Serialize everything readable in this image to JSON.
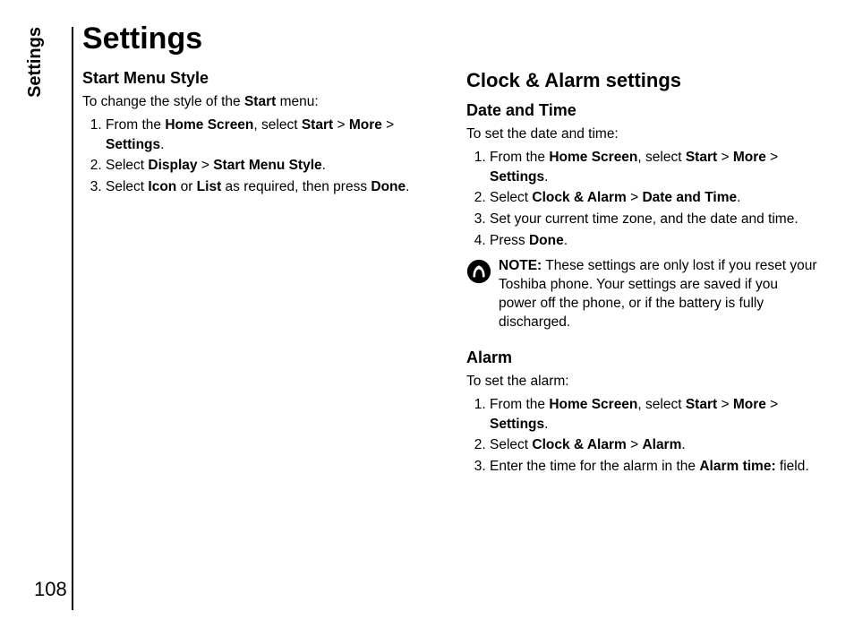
{
  "sideLabel": "Settings",
  "pageNumber": "108",
  "title": "Settings",
  "left": {
    "h": "Start Menu Style",
    "intro_pre": "To change the style of the ",
    "intro_b": "Start",
    "intro_post": " menu:",
    "s1_a": "From the ",
    "s1_b": "Home Screen",
    "s1_c": ", select ",
    "s1_d": "Start",
    "s1_e": " > ",
    "s1_f": "More",
    "s1_g": " > ",
    "s1_h": "Settings",
    "s1_i": ".",
    "s2_a": "Select ",
    "s2_b": "Display",
    "s2_c": " > ",
    "s2_d": "Start Menu Style",
    "s2_e": ".",
    "s3_a": "Select ",
    "s3_b": "Icon",
    "s3_c": " or ",
    "s3_d": "List",
    "s3_e": " as required, then press ",
    "s3_f": "Done",
    "s3_g": "."
  },
  "right": {
    "h": "Clock & Alarm settings",
    "dt": {
      "h": "Date and Time",
      "intro": "To set the date and time:",
      "s1_a": "From the ",
      "s1_b": "Home Screen",
      "s1_c": ", select ",
      "s1_d": "Start",
      "s1_e": " > ",
      "s1_f": "More",
      "s1_g": " > ",
      "s1_h": "Settings",
      "s1_i": ".",
      "s2_a": "Select ",
      "s2_b": "Clock & Alarm",
      "s2_c": " > ",
      "s2_d": "Date and Time",
      "s2_e": ".",
      "s3": "Set your current time zone, and the date and time.",
      "s4_a": "Press ",
      "s4_b": "Done",
      "s4_c": ".",
      "note_b": "NOTE:",
      "note_t": " These settings are only lost if you reset your Toshiba phone. Your settings are saved if you power off the phone, or if the battery is fully discharged."
    },
    "al": {
      "h": "Alarm",
      "intro": "To set the alarm:",
      "s1_a": "From the ",
      "s1_b": "Home Screen",
      "s1_c": ", select ",
      "s1_d": "Start",
      "s1_e": " > ",
      "s1_f": "More",
      "s1_g": " > ",
      "s1_h": "Settings",
      "s1_i": ".",
      "s2_a": "Select ",
      "s2_b": "Clock & Alarm",
      "s2_c": " > ",
      "s2_d": "Alarm",
      "s2_e": ".",
      "s3_a": "Enter the time for the alarm in the ",
      "s3_b": "Alarm time:",
      "s3_c": " field."
    }
  }
}
